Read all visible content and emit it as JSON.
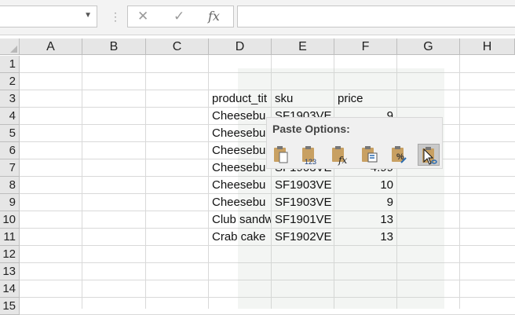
{
  "formula_bar": {
    "fx_label": "fx",
    "formula_value": ""
  },
  "columns": [
    "A",
    "B",
    "C",
    "D",
    "E",
    "F",
    "G",
    "H"
  ],
  "rows": [
    "1",
    "2",
    "3",
    "4",
    "5",
    "6",
    "7",
    "8",
    "9",
    "10",
    "11",
    "12",
    "13",
    "14",
    "15"
  ],
  "cells": {
    "D3": "product_tit",
    "E3": "sku",
    "F3": "price",
    "D4": "Cheesebu",
    "E4": "SF1903VE",
    "F4": "9",
    "D5": "Cheesebu",
    "D6": "Cheesebu",
    "D7": "Cheesebu",
    "E7": "SF1903VE",
    "F7": "4.99",
    "D8": "Cheesebu",
    "E8": "SF1903VE",
    "F8": "10",
    "D9": "Cheesebu",
    "E9": "SF1903VE",
    "F9": "9",
    "D10": "Club sandw",
    "E10": "SF1901VE",
    "F10": "13",
    "D11": "Crab cake",
    "E11": "SF1902VE",
    "F11": "13"
  },
  "paste_options": {
    "title": "Paste Options:",
    "icons": [
      "paste-icon",
      "paste-values-icon",
      "paste-formulas-icon",
      "paste-transpose-icon",
      "paste-formatting-icon",
      "paste-link-icon"
    ],
    "selected": "paste-link-icon"
  }
}
